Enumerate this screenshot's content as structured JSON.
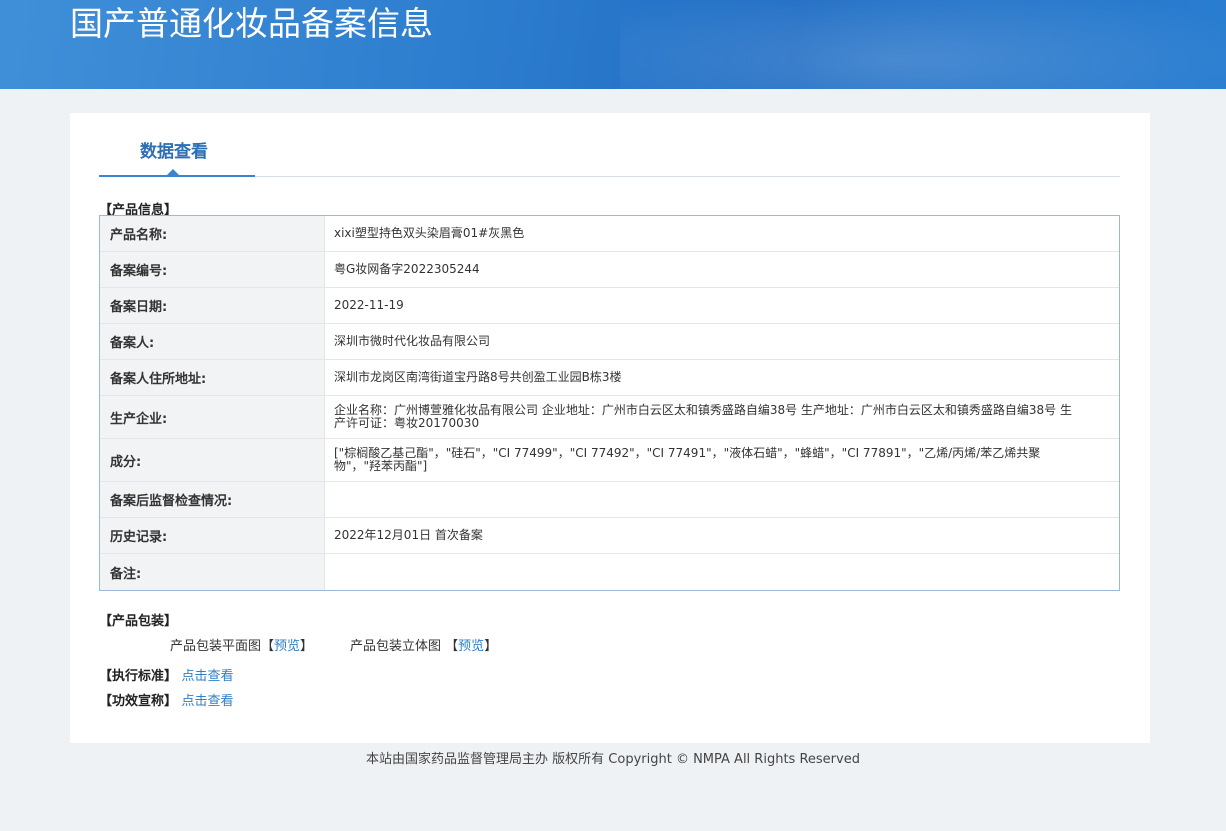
{
  "header": {
    "title": "国产普通化妆品备案信息"
  },
  "tabs": {
    "active_label": "数据查看"
  },
  "product_info": {
    "section_title": "【产品信息】",
    "rows": [
      {
        "label": "产品名称:",
        "value": "xixi塑型持色双头染眉膏01#灰黑色"
      },
      {
        "label": "备案编号:",
        "value": "粤G妆网备字2022305244"
      },
      {
        "label": "备案日期:",
        "value": "2022-11-19"
      },
      {
        "label": "备案人:",
        "value": "深圳市微时代化妆品有限公司"
      },
      {
        "label": "备案人住所地址:",
        "value": "深圳市龙岗区南湾街道宝丹路8号共创盈工业园B栋3楼"
      },
      {
        "label": "生产企业:",
        "value": "企业名称：广州博萱雅化妆品有限公司 企业地址：广州市白云区太和镇秀盛路自编38号 生产地址：广州市白云区太和镇秀盛路自编38号 生产许可证：粤妆20170030"
      },
      {
        "label": "成分:",
        "value": "[\"棕榈酸乙基己酯\"，\"硅石\"，\"CI 77499\"，\"CI 77492\"，\"CI 77491\"，\"液体石蜡\"，\"蜂蜡\"，\"CI 77891\"，\"乙烯/丙烯/苯乙烯共聚物\"，\"羟苯丙酯\"]"
      },
      {
        "label": "备案后监督检查情况:",
        "value": ""
      },
      {
        "label": "历史记录:",
        "value": "2022年12月01日 首次备案"
      },
      {
        "label": "备注:",
        "value": ""
      }
    ]
  },
  "packaging": {
    "section_title": "【产品包装】",
    "flat_label": "产品包装平面图",
    "solid_label": "产品包装立体图",
    "bracket_open": "【",
    "bracket_close": "】",
    "preview_link": "预览"
  },
  "standard": {
    "section_title": "【执行标准】",
    "link": "点击查看"
  },
  "claims": {
    "section_title": "【功效宣称】",
    "link": "点击查看"
  },
  "footer": {
    "text": "本站由国家药品监督管理局主办 版权所有 Copyright © NMPA All Rights Reserved"
  }
}
